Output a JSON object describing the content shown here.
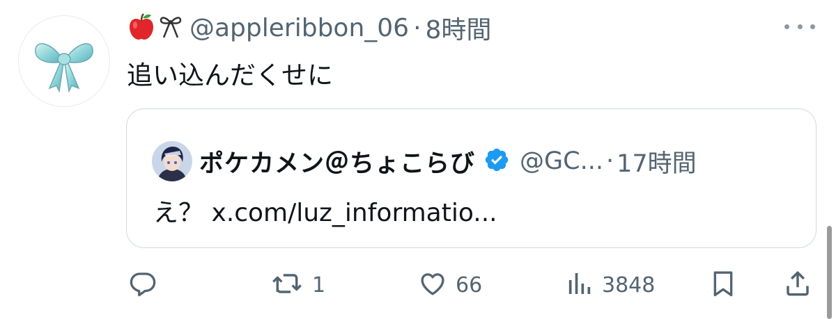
{
  "tweet": {
    "avatar_icon": "blue-ribbon-bow-icon",
    "display_name_emojis": [
      "red-apple-icon",
      "ribbon-icon"
    ],
    "handle": "@appleribbon_06",
    "separator": "·",
    "time": "8時間",
    "text": "追い込んだくせに",
    "more_icon": "more-options-icon"
  },
  "quote": {
    "avatar_icon": "anime-character-avatar",
    "name": "ポケカメン＠ちょこらび",
    "verified": true,
    "handle": "@GC...",
    "separator": "·",
    "time": "17時間",
    "text": "え？ x.com/luz_informatio..."
  },
  "actions": {
    "reply": {
      "icon": "reply-icon",
      "count": ""
    },
    "retweet": {
      "icon": "retweet-icon",
      "count": "1"
    },
    "like": {
      "icon": "heart-icon",
      "count": "66"
    },
    "views": {
      "icon": "views-chart-icon",
      "count": "3848"
    },
    "bookmark": {
      "icon": "bookmark-icon"
    },
    "share": {
      "icon": "share-icon"
    }
  },
  "colors": {
    "text_primary": "#0f1419",
    "text_secondary": "#536471",
    "border": "#cfd9de",
    "verified_blue": "#1d9bf0"
  }
}
